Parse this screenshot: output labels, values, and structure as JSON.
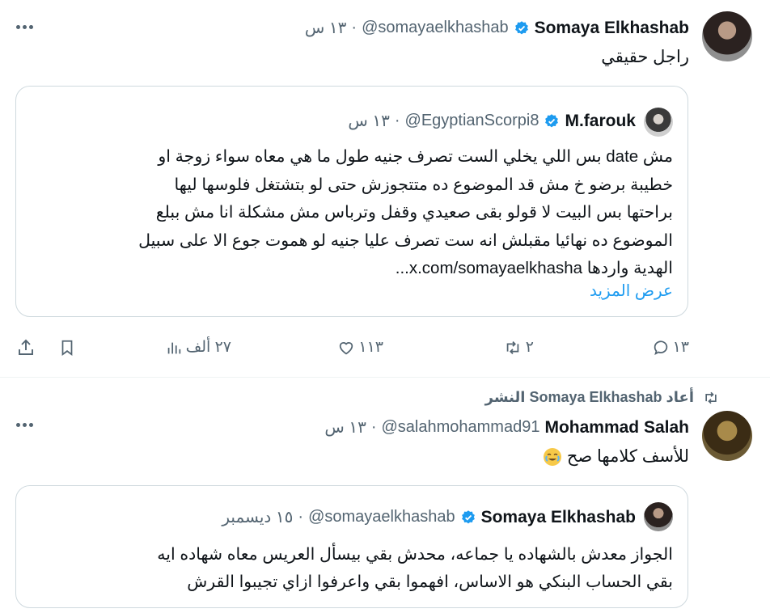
{
  "tweet1": {
    "author_name": "Somaya Elkhashab",
    "handle": "@somayaelkhashab",
    "time": "١٣ س",
    "text": "راجل حقيقي",
    "quote": {
      "author_name": "M.farouk",
      "handle": "@EgyptianScorpi8",
      "time": "١٣ س",
      "lines": [
        "مش date بس اللي يخلي الست تصرف جنيه طول ما هي معاه سواء زوجة او",
        "خطيبة برضو خ مش قد الموضوع ده متتجوزش حتى لو بتشتغل فلوسها ليها",
        "براحتها بس البيت لا قولو بقى صعيدي وقفل وترباس مش مشكلة انا مش ببلع",
        "الموضوع ده نهائيا مقبلش انه ست تصرف عليا جنيه لو هموت جوع الا على سبيل",
        "الهدية واردها x.com/somayaelkhasha..."
      ],
      "show_more": "عرض المزيد"
    },
    "actions": {
      "replies": "١٣",
      "reposts": "٢",
      "likes": "١١٣",
      "views": "٢٧ ألف"
    }
  },
  "repost_notice": "أعاد Somaya Elkhashab النشر",
  "tweet2": {
    "author_name": "Mohammad Salah",
    "handle": "@salahmohammad91",
    "time": "١٣ س",
    "text": "للأسف كلامها صح",
    "emoji": "crying-smile-emoji",
    "quote": {
      "author_name": "Somaya Elkhashab",
      "handle": "@somayaelkhashab",
      "time": "١٥ ديسمبر",
      "lines": [
        "الجواز معدش بالشهاده يا جماعه، محدش بقي بيسأل العريس معاه شهاده ايه",
        "بقي الحساب البنكي هو الاساس، افهموا بقي واعرفوا ازاي تجيبوا القرش"
      ]
    }
  },
  "colors": {
    "verified": "#1d9bf0",
    "link": "#1d9bf0",
    "secondary_text": "#536471",
    "border": "#cfd9de"
  },
  "icons": [
    "more-icon",
    "verified-badge-icon",
    "reply-icon",
    "repost-icon",
    "like-icon",
    "views-icon",
    "bookmark-icon",
    "share-icon"
  ]
}
